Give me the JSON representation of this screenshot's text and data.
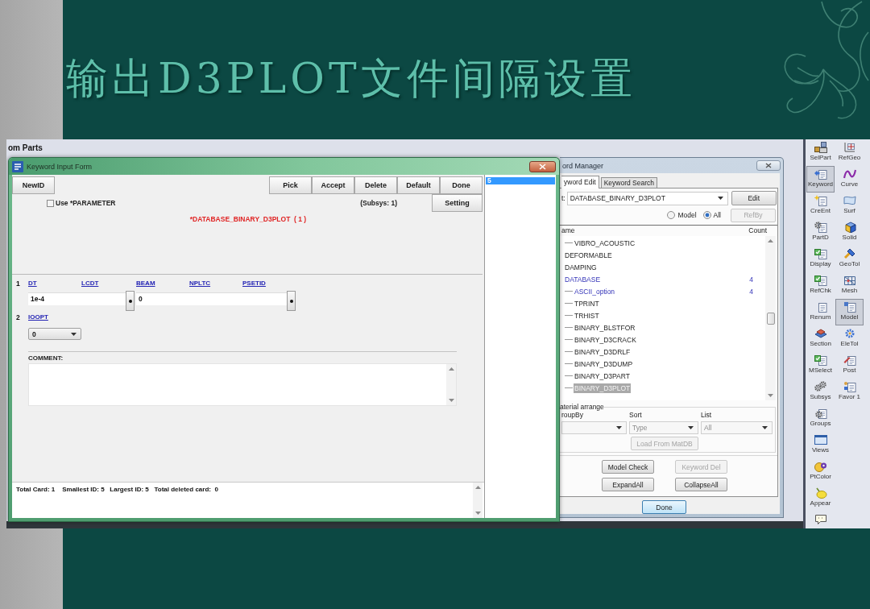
{
  "slide": {
    "title": "输出D3PLOT文件间隔设置"
  },
  "workspace": {
    "heading": "om Parts"
  },
  "keyword_input_form": {
    "title": "Keyword Input Form",
    "new_id_button": "NewID",
    "buttons": [
      "Pick",
      "Accept",
      "Delete",
      "Default",
      "Done"
    ],
    "use_parameter": {
      "label": "Use *PARAMETER",
      "checked": false
    },
    "subsys": "(Subsys: 1)",
    "setting_button": "Setting",
    "keyword": "*DATABASE_BINARY_D3PLOT  ( 1 )",
    "cards": [
      {
        "number": "1",
        "fields": [
          {
            "kind": "text",
            "label": "DT",
            "value": "1e-4"
          },
          {
            "kind": "text",
            "label": "LCDT"
          },
          {
            "kind": "pick"
          },
          {
            "kind": "text",
            "label": "BEAM",
            "value": "0"
          },
          {
            "kind": "text",
            "label": "NPLTC"
          },
          {
            "kind": "text",
            "label": "PSETID"
          },
          {
            "kind": "pick"
          }
        ]
      },
      {
        "number": "2",
        "fields": [
          {
            "kind": "dropdown",
            "label": "IOOPT",
            "value": "0"
          }
        ]
      }
    ],
    "comment": {
      "label": "COMMENT:"
    },
    "status": "Total Card: 1    Smallest ID: 5   Largest ID: 5   Total deleted card:  0",
    "id_list": [
      {
        "label": "5",
        "selected": true
      }
    ]
  },
  "keyword_manager": {
    "title": "ord Manager",
    "tabs": [
      {
        "label": "yword Edit",
        "selected": true
      },
      {
        "label": "Keyword Search",
        "selected": false
      }
    ],
    "keyword_label": "t:",
    "keyword_value": "DATABASE_BINARY_D3PLOT",
    "edit_button": "Edit",
    "scope": [
      {
        "label": "Model",
        "selected": false
      },
      {
        "label": "All",
        "selected": true
      }
    ],
    "refby_button": {
      "label": "RefBy",
      "disabled": true
    },
    "columns": [
      "ame",
      "Count"
    ],
    "tree": [
      {
        "children": [
          {
            "label": "VIBRO_ACOUSTIC",
            "selected": false
          }
        ]
      },
      {
        "label": "DEFORMABLE",
        "selected": false
      },
      {
        "label": "DAMPING",
        "selected": false
      },
      {
        "label": "DATABASE",
        "count": "4",
        "selected": false,
        "children": [
          {
            "label": "ASCII_option",
            "count": "4",
            "selected": false
          },
          {
            "label": "TPRINT",
            "selected": false
          },
          {
            "label": "TRHIST",
            "selected": false
          },
          {
            "label": "BINARY_BLSTFOR",
            "selected": false
          },
          {
            "label": "BINARY_D3CRACK",
            "selected": false
          },
          {
            "label": "BINARY_D3DRLF",
            "selected": false
          },
          {
            "label": "BINARY_D3DUMP",
            "selected": false
          },
          {
            "label": "BINARY_D3PART",
            "selected": false
          },
          {
            "label": "BINARY_D3PLOT",
            "selected": true
          }
        ]
      }
    ],
    "material_arrange": {
      "title": "aterial arrange",
      "filters": [
        {
          "label": "roupBy"
        },
        {
          "label": "Sort",
          "value": "Type"
        },
        {
          "label": "List",
          "value": "All"
        }
      ],
      "load_button": {
        "label": "Load From MatDB",
        "disabled": true
      }
    },
    "actions": [
      {
        "label": "Model Check",
        "disabled": false
      },
      {
        "label": "Keyword Del",
        "disabled": true
      },
      {
        "label": "ExpandAll",
        "disabled": false
      },
      {
        "label": "CollapseAll",
        "disabled": false
      }
    ],
    "done_button": "Done"
  },
  "toolbar": {
    "columns": [
      [
        {
          "label": "SelPart",
          "selected": false
        },
        {
          "label": "Keyword",
          "selected": true
        },
        {
          "label": "CreEnt",
          "selected": false
        },
        {
          "label": "PartD",
          "selected": false
        },
        {
          "label": "Display",
          "selected": false
        },
        {
          "label": "RefChk",
          "selected": false
        },
        {
          "label": "Renum",
          "selected": false
        },
        {
          "label": "Section",
          "selected": false
        },
        {
          "label": "MSelect",
          "selected": false
        },
        {
          "label": "Subsys",
          "selected": false
        },
        {
          "label": "Groups",
          "selected": false
        },
        {
          "label": "Views",
          "selected": false
        },
        {
          "label": "PtColor",
          "selected": false
        },
        {
          "label": "Appear",
          "selected": false
        },
        {
          "selected": false
        }
      ],
      [
        {
          "label": "RefGeo",
          "selected": false
        },
        {
          "label": "Curve",
          "selected": false
        },
        {
          "label": "Surf",
          "selected": false
        },
        {
          "label": "Solid",
          "selected": false
        },
        {
          "label": "GeoTol",
          "selected": false
        },
        {
          "label": "Mesh",
          "selected": false
        },
        {
          "label": "Model",
          "selected": true
        },
        {
          "label": "EleTol",
          "selected": false
        },
        {
          "label": "Post",
          "selected": false
        },
        {
          "label": "Favor 1",
          "selected": false
        }
      ]
    ]
  }
}
